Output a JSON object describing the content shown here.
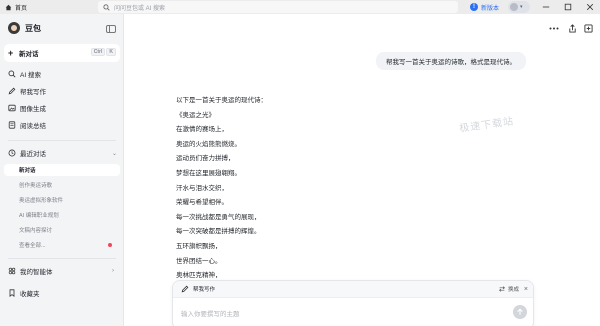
{
  "titlebar": {
    "home_tab": "首页",
    "address_placeholder": "问问豆包或 AI 搜索",
    "new_version": "新版本",
    "new_version_badge": "!"
  },
  "sidebar": {
    "brand": "豆包",
    "new_chat": "新对话",
    "new_chat_keys": [
      "Ctrl",
      "K"
    ],
    "nav": [
      {
        "label": "AI 搜索",
        "icon": "search-icon"
      },
      {
        "label": "帮我写作",
        "icon": "pen-icon"
      },
      {
        "label": "图像生成",
        "icon": "image-icon"
      },
      {
        "label": "阅读总结",
        "icon": "book-icon"
      }
    ],
    "recent_title": "最近对话",
    "recent": [
      {
        "label": "新对话",
        "active": true
      },
      {
        "label": "创作奥运诗歌",
        "active": false
      },
      {
        "label": "奥运虚拟形象软件",
        "active": false
      },
      {
        "label": "AI 编辑职业规划",
        "active": false
      },
      {
        "label": "文稿内容探讨",
        "active": false
      },
      {
        "label": "查看全部...",
        "active": false
      }
    ],
    "my_agents": "我的智能体",
    "favorites": "收藏夹"
  },
  "main": {
    "user_message": "帮我写一首关于奥运的诗歌，格式是现代诗。",
    "answer_lines": [
      "以下是一首关于奥运的现代诗：",
      "《奥运之光》",
      "在激情的赛场上，",
      "奥运的火焰熊熊燃烧。",
      "运动员们奋力拼搏，",
      "梦想在这里展翅翱翔。",
      "汗水与泪水交织，",
      "荣耀与希望相伴。",
      "每一次挑战都是勇气的展现，",
      "每一次突破都是拼搏的辉煌。",
      "五环旗帜飘扬，",
      "世界团结一心。",
      "奥林匹克精神，"
    ],
    "watermark": "极速下载站"
  },
  "composer": {
    "mode": "帮我写作",
    "switch_label": "换成",
    "placeholder": "输入你要撰写的主题"
  },
  "colors": {
    "accent": "#2b6ff3",
    "sidebar_bg": "#f3f4f6",
    "red_dot": "#f5455c"
  }
}
